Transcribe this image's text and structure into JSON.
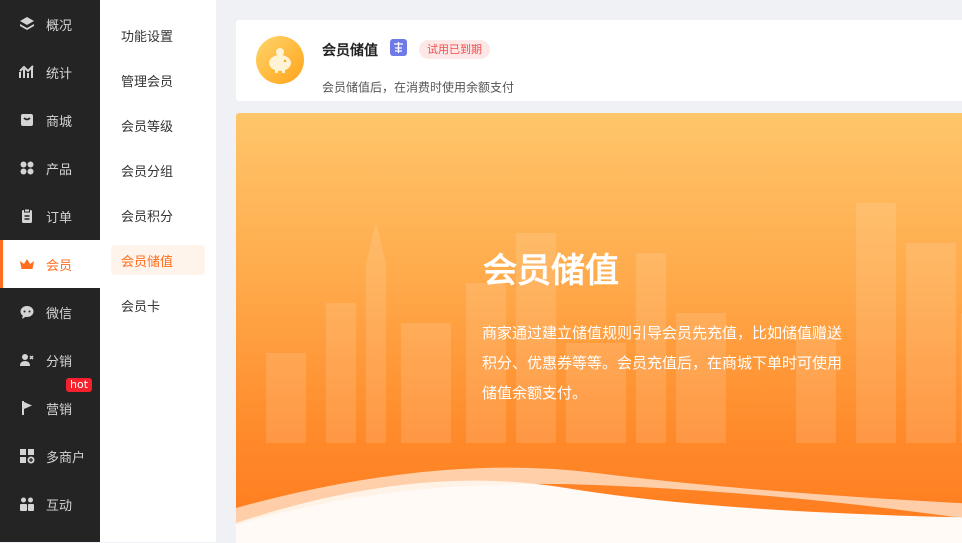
{
  "sidebar": {
    "items": [
      {
        "label": "概况",
        "icon": "layers-icon"
      },
      {
        "label": "统计",
        "icon": "chart-icon"
      },
      {
        "label": "商城",
        "icon": "store-icon"
      },
      {
        "label": "产品",
        "icon": "grid-icon"
      },
      {
        "label": "订单",
        "icon": "clipboard-icon"
      },
      {
        "label": "会员",
        "icon": "crown-icon"
      },
      {
        "label": "微信",
        "icon": "chat-icon"
      },
      {
        "label": "分销",
        "icon": "users-icon"
      },
      {
        "label": "营销",
        "icon": "flag-icon",
        "badge": "hot"
      },
      {
        "label": "多商户",
        "icon": "shop-plus-icon"
      },
      {
        "label": "互动",
        "icon": "interact-icon"
      }
    ],
    "active_index": 5
  },
  "submenu": {
    "items": [
      "功能设置",
      "管理会员",
      "会员等级",
      "会员分组",
      "会员积分",
      "会员储值",
      "会员卡"
    ],
    "active_index": 5
  },
  "feature_card": {
    "title": "会员储值",
    "status_tag": "试用已到期",
    "description": "会员储值后，在消费时使用余额支付"
  },
  "banner": {
    "title": "会员储值",
    "text": "商家通过建立储值规则引导会员先充值，比如储值赠送积分、优惠券等等。会员充值后，在商城下单时可使用储值余额支付。"
  },
  "colors": {
    "accent": "#ff6e1f",
    "sidebar_bg": "#242424",
    "hot_badge": "#f5222d",
    "tag_blue": "#6f79e8"
  }
}
